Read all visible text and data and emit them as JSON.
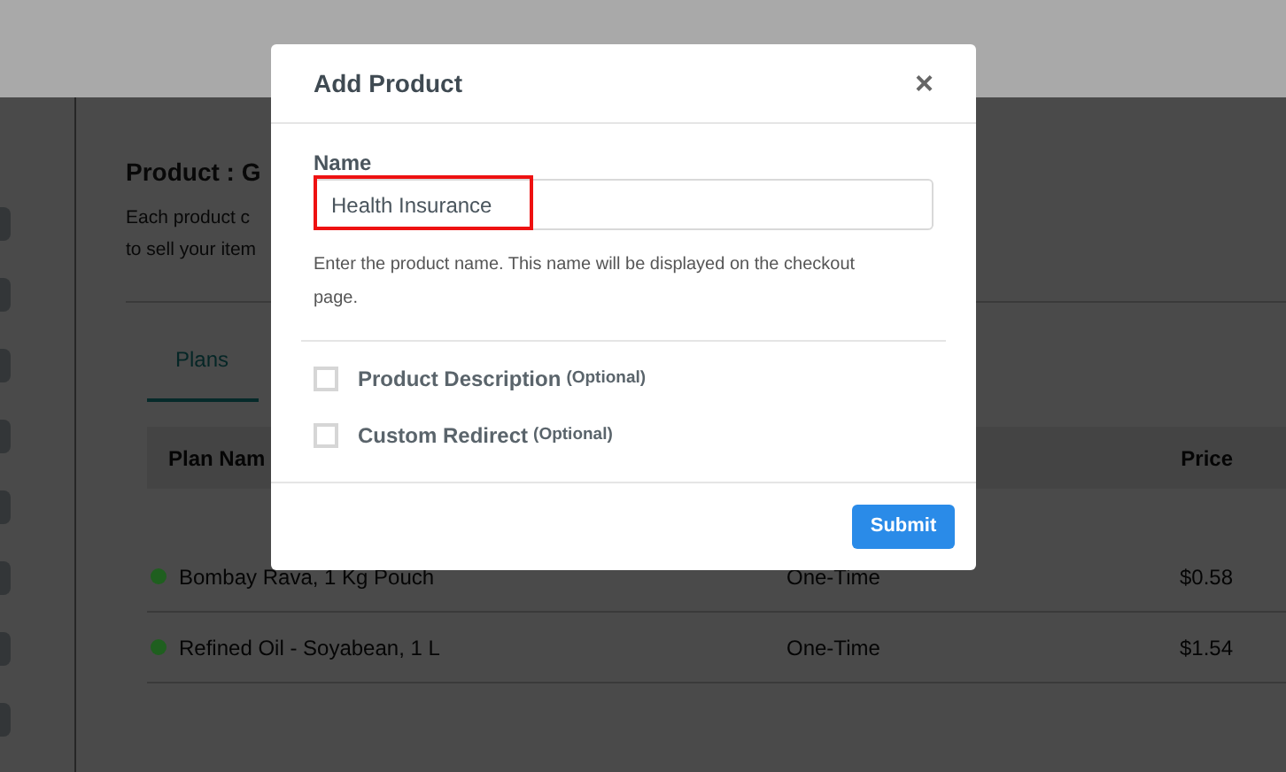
{
  "page": {
    "heading": "Product : G",
    "description_lines": [
      "Each product c",
      "to sell your item"
    ],
    "tabs": [
      {
        "label": "Plans",
        "selected": true
      }
    ],
    "table": {
      "columns": [
        "Plan Nam",
        "Price"
      ],
      "rows": [
        {
          "name": "Bombay Rava, 1 Kg Pouch",
          "billing": "One-Time",
          "price": "$0.58",
          "color": "#1f5f1f"
        },
        {
          "name": "Refined Oil - Soyabean, 1 L",
          "billing": "One-Time",
          "price": "$1.54",
          "color": "#1f5f1f"
        }
      ]
    }
  },
  "modal": {
    "title": "Add Product",
    "close": "×",
    "field": {
      "label": "Name",
      "value": "Health Insurance",
      "help": "Enter the product name. This name will be displayed on the checkout page.",
      "highlighted": true
    },
    "options": [
      {
        "label": "Product Description",
        "note": "(Optional)",
        "checked": false
      },
      {
        "label": "Custom Redirect",
        "note": "(Optional)",
        "checked": false
      }
    ],
    "submit": "Submit"
  }
}
